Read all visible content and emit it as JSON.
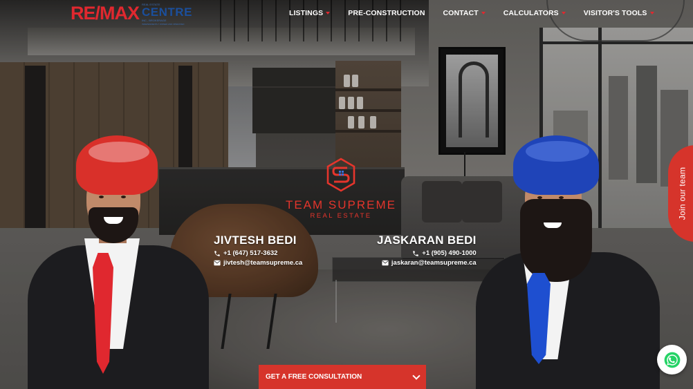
{
  "header": {
    "logo": {
      "remax": "RE/MAX",
      "small_top": "REAL ESTATE",
      "centre": "CENTRE",
      "small_mid": "INC., BROKERAGE",
      "tagline": "INDEPENDENTLY OWNED AND OPERATED"
    },
    "nav": [
      {
        "label": "LISTINGS",
        "has_dropdown": true
      },
      {
        "label": "PRE-CONSTRUCTION",
        "has_dropdown": false
      },
      {
        "label": "CONTACT",
        "has_dropdown": true
      },
      {
        "label": "CALCULATORS",
        "has_dropdown": true
      },
      {
        "label": "VISITOR'S TOOLS",
        "has_dropdown": true
      }
    ]
  },
  "brand": {
    "name": "TEAM SUPREME",
    "subtitle": "REAL ESTATE",
    "color": "#e5352c"
  },
  "agents": [
    {
      "name": "JIVTESH BEDI",
      "phone": "+1 (647) 517-3632",
      "email": "jivtesh@teamsupreme.ca",
      "turban_color": "#d9302a",
      "tie_color": "#e0282f"
    },
    {
      "name": "JASKARAN BEDI",
      "phone": "+1 (905) 490-1000",
      "email": "jaskaran@teamsupreme.ca",
      "turban_color": "#1f44b8",
      "tie_color": "#1e4fd0"
    }
  ],
  "side_tab": {
    "label": "Join our team"
  },
  "cta": {
    "label": "GET A FREE CONSULTATION"
  },
  "icons": {
    "phone": "phone-icon",
    "email": "email-icon",
    "whatsapp": "whatsapp-icon",
    "chevron": "chevron-down-icon"
  },
  "colors": {
    "accent": "#d6342b",
    "remax_red": "#e0282f",
    "remax_blue": "#1b4f9c",
    "whatsapp_green": "#25d366"
  }
}
